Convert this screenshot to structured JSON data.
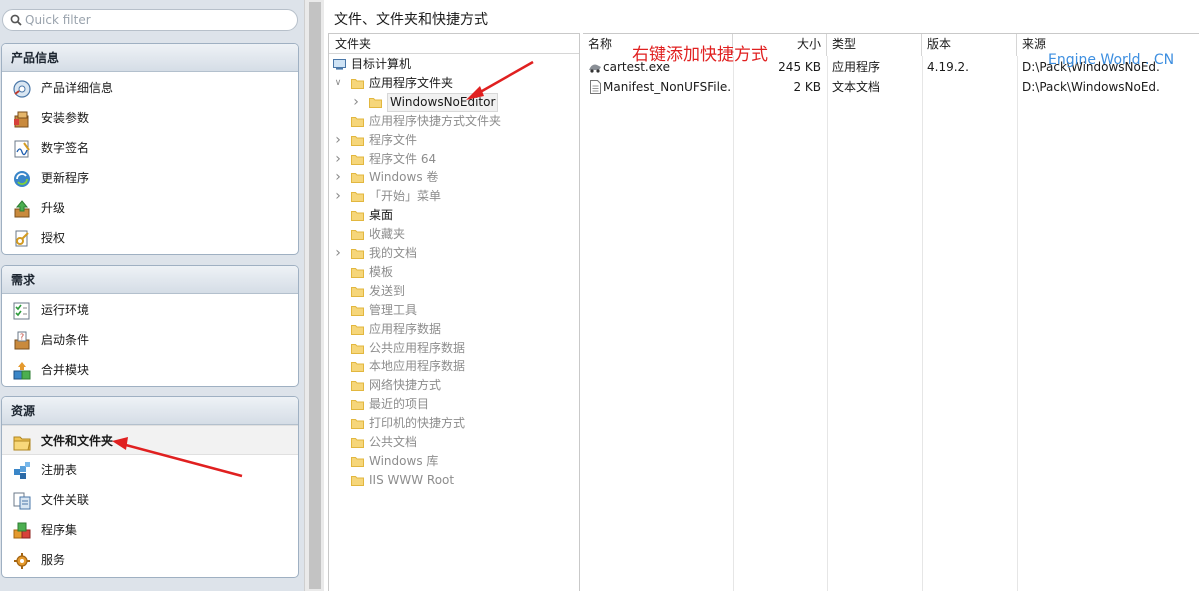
{
  "sidebar": {
    "quick_filter_placeholder": "Quick filter",
    "groups": [
      {
        "title": "产品信息",
        "items": [
          {
            "label": "产品详细信息",
            "icon": "product-details-icon"
          },
          {
            "label": "安装参数",
            "icon": "install-parameters-icon"
          },
          {
            "label": "数字签名",
            "icon": "digital-signature-icon"
          },
          {
            "label": "更新程序",
            "icon": "updater-icon"
          },
          {
            "label": "升级",
            "icon": "upgrade-icon"
          },
          {
            "label": "授权",
            "icon": "licensing-icon"
          }
        ]
      },
      {
        "title": "需求",
        "items": [
          {
            "label": "运行环境",
            "icon": "requirements-icon"
          },
          {
            "label": "启动条件",
            "icon": "launch-conditions-icon"
          },
          {
            "label": "合并模块",
            "icon": "merge-modules-icon"
          }
        ]
      },
      {
        "title": "资源",
        "items": [
          {
            "label": "文件和文件夹",
            "icon": "files-folders-icon"
          },
          {
            "label": "注册表",
            "icon": "registry-icon"
          },
          {
            "label": "文件关联",
            "icon": "file-associations-icon"
          },
          {
            "label": "程序集",
            "icon": "assemblies-icon"
          },
          {
            "label": "服务",
            "icon": "services-icon"
          }
        ]
      }
    ]
  },
  "main": {
    "title": "文件、文件夹和快捷方式",
    "tree": {
      "header": "文件夹",
      "nodes": [
        {
          "label": "目标计算机"
        },
        {
          "label": "应用程序文件夹"
        },
        {
          "label": "WindowsNoEditor"
        },
        {
          "label": "应用程序快捷方式文件夹"
        },
        {
          "label": "程序文件"
        },
        {
          "label": "程序文件 64"
        },
        {
          "label": "Windows 卷"
        },
        {
          "label": "「开始」菜单"
        },
        {
          "label": "桌面"
        },
        {
          "label": "收藏夹"
        },
        {
          "label": "我的文档"
        },
        {
          "label": "模板"
        },
        {
          "label": "发送到"
        },
        {
          "label": "管理工具"
        },
        {
          "label": "应用程序数据"
        },
        {
          "label": "公共应用程序数据"
        },
        {
          "label": "本地应用程序数据"
        },
        {
          "label": "网络快捷方式"
        },
        {
          "label": "最近的项目"
        },
        {
          "label": "打印机的快捷方式"
        },
        {
          "label": "公共文档"
        },
        {
          "label": "Windows 库"
        },
        {
          "label": "IIS WWW Root"
        }
      ]
    },
    "files": {
      "columns": [
        "名称",
        "大小",
        "类型",
        "版本",
        "来源"
      ],
      "rows": [
        {
          "name": "cartest.exe",
          "size": "245 KB",
          "type": "应用程序",
          "version": "4.19.2.:",
          "source": "D:\\Pack\\WindowsNoEd..."
        },
        {
          "name": "Manifest_NonUFSFile...",
          "size": "2 KB",
          "type": "文本文档",
          "version": "",
          "source": "D:\\Pack\\WindowsNoEd..."
        }
      ]
    }
  },
  "annotations": {
    "callout": "右键添加快捷方式",
    "watermark": "Engine World . CN",
    "arrow_color": "#e02020"
  }
}
